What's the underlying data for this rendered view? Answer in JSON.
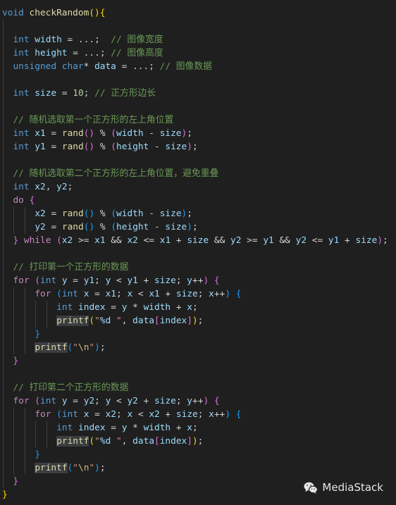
{
  "editor": {
    "theme": {
      "background": "#1f1f1f",
      "keyword": "#569cd6",
      "control": "#c586c0",
      "variable": "#9cdcfe",
      "function": "#dcdcaa",
      "number": "#b5cea8",
      "string": "#ce9178",
      "comment": "#6a9955",
      "bracket_levels": [
        "#ffd700",
        "#da70d6",
        "#179fff"
      ]
    },
    "code_lines": [
      "void checkRandom(){",
      "",
      "  int width = ...;  // 图像宽度",
      "  int height = ...; // 图像高度",
      "  unsigned char* data = ...; // 图像数据",
      "",
      "  int size = 10; // 正方形边长",
      "",
      "  // 随机选取第一个正方形的左上角位置",
      "  int x1 = rand() % (width - size);",
      "  int y1 = rand() % (height - size);",
      "",
      "  // 随机选取第二个正方形的左上角位置，避免重叠",
      "  int x2, y2;",
      "  do {",
      "      x2 = rand() % (width - size);",
      "      y2 = rand() % (height - size);",
      "  } while (x2 >= x1 && x2 <= x1 + size && y2 >= y1 && y2 <= y1 + size);",
      "",
      "  // 打印第一个正方形的数据",
      "  for (int y = y1; y < y1 + size; y++) {",
      "      for (int x = x1; x < x1 + size; x++) {",
      "          int index = y * width + x;",
      "          printf(\"%d \", data[index]);",
      "      }",
      "      printf(\"\\n\");",
      "  }",
      "",
      "  // 打印第二个正方形的数据",
      "  for (int y = y2; y < y2 + size; y++) {",
      "      for (int x = x2; x < x2 + size; x++) {",
      "          int index = y * width + x;",
      "          printf(\"%d \", data[index]);",
      "      }",
      "      printf(\"\\n\");",
      "  }",
      "}"
    ],
    "highlighted_word": "printf"
  },
  "watermark": {
    "icon": "wechat-icon",
    "label": "MediaStack"
  }
}
